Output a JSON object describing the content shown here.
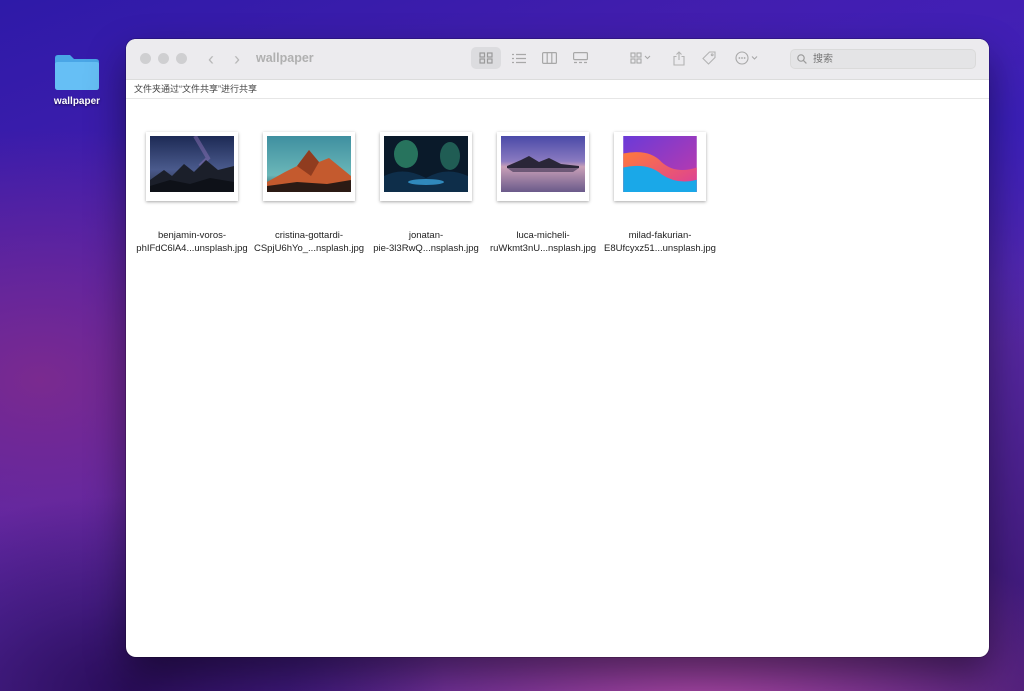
{
  "desktop": {
    "folder_label": "wallpaper"
  },
  "window": {
    "title": "wallpaper",
    "share_notice": "文件夹通过“文件共享”进行共享",
    "search": {
      "placeholder": "搜索"
    }
  },
  "files": [
    {
      "name_line1": "benjamin-voros-",
      "name_line2": "phIFdC6lA4...unsplash.jpg"
    },
    {
      "name_line1": "cristina-gottardi-",
      "name_line2": "CSpjU6hYo_...nsplash.jpg"
    },
    {
      "name_line1": "jonatan-",
      "name_line2": "pie-3l3RwQ...nsplash.jpg"
    },
    {
      "name_line1": "luca-micheli-",
      "name_line2": "ruWkmt3nU...nsplash.jpg"
    },
    {
      "name_line1": "milad-fakurian-",
      "name_line2": "E8Ufcyxz51...unsplash.jpg"
    }
  ],
  "colors": {
    "accent": "#5fb8f2",
    "toolbar_bg": "#ecebee"
  }
}
